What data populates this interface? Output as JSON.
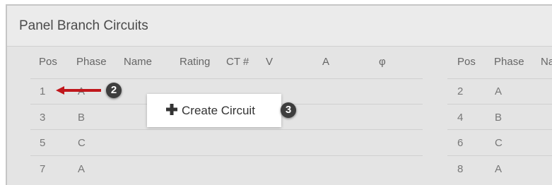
{
  "panel": {
    "title": "Panel Branch Circuits"
  },
  "table_left": {
    "headers": [
      "Pos",
      "Phase",
      "Name",
      "Rating",
      "CT #",
      "V",
      "A",
      "φ"
    ],
    "rows": [
      {
        "pos": "1",
        "phase": "A"
      },
      {
        "pos": "3",
        "phase": "B"
      },
      {
        "pos": "5",
        "phase": "C"
      },
      {
        "pos": "7",
        "phase": "A"
      }
    ]
  },
  "table_right": {
    "headers": [
      "Pos",
      "Phase",
      "Na"
    ],
    "rows": [
      {
        "pos": "2",
        "phase": "A"
      },
      {
        "pos": "4",
        "phase": "B"
      },
      {
        "pos": "6",
        "phase": "C"
      },
      {
        "pos": "8",
        "phase": "A"
      }
    ]
  },
  "popup": {
    "label": "Create Circuit",
    "icon": "plus-icon"
  },
  "callouts": {
    "step2": "2",
    "step3": "3"
  },
  "colors": {
    "arrow": "#c0171c",
    "badge": "#3d3d3d"
  }
}
